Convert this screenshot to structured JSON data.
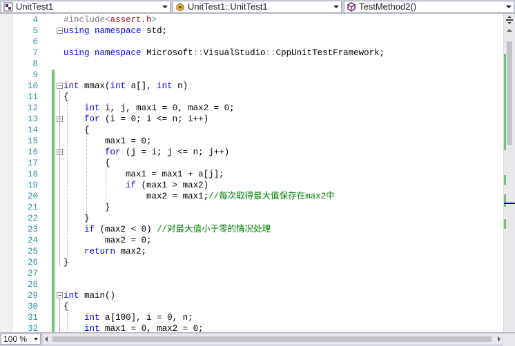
{
  "navbar": {
    "project": {
      "label": "UnitTest1",
      "icon": "project-icon"
    },
    "scope": {
      "label": "UnitTest1::UnitTest1",
      "icon": "class-icon"
    },
    "member": {
      "label": "TestMethod2()",
      "icon": "method-icon"
    }
  },
  "editor": {
    "lines": [
      {
        "n": "4",
        "text": "#include<assert.h>"
      },
      {
        "n": "5",
        "text": "using namespace std;"
      },
      {
        "n": "6",
        "text": ""
      },
      {
        "n": "7",
        "text": "using namespace Microsoft::VisualStudio::CppUnitTestFramework;"
      },
      {
        "n": "8",
        "text": ""
      },
      {
        "n": "9",
        "text": ""
      },
      {
        "n": "10",
        "text": "int mmax(int a[], int n)"
      },
      {
        "n": "11",
        "text": "{"
      },
      {
        "n": "12",
        "text": "    int i, j, max1 = 0, max2 = 0;"
      },
      {
        "n": "13",
        "text": "    for (i = 0; i <= n; i++)"
      },
      {
        "n": "14",
        "text": "    {"
      },
      {
        "n": "15",
        "text": "        max1 = 0;"
      },
      {
        "n": "16",
        "text": "        for (j = i; j <= n; j++)"
      },
      {
        "n": "17",
        "text": "        {"
      },
      {
        "n": "18",
        "text": "            max1 = max1 + a[j];"
      },
      {
        "n": "19",
        "text": "            if (max1 > max2)"
      },
      {
        "n": "20",
        "text": "                max2 = max1;//每次取得最大值保存在max2中"
      },
      {
        "n": "21",
        "text": "        }"
      },
      {
        "n": "22",
        "text": "    }"
      },
      {
        "n": "23",
        "text": "    if (max2 < 0) //对最大值小于零的情况处理"
      },
      {
        "n": "24",
        "text": "        max2 = 0;"
      },
      {
        "n": "25",
        "text": "    return max2;"
      },
      {
        "n": "26",
        "text": "}"
      },
      {
        "n": "27",
        "text": ""
      },
      {
        "n": "28",
        "text": ""
      },
      {
        "n": "29",
        "text": "int main()"
      },
      {
        "n": "30",
        "text": "{"
      },
      {
        "n": "31",
        "text": "    int a[100], i = 0, n;"
      },
      {
        "n": "32",
        "text": "    int max1 = 0, max2 = 0;"
      }
    ]
  },
  "statusbar": {
    "zoom": "100 %"
  },
  "colors": {
    "keyword": "#0000ff",
    "preprocessor": "#808080",
    "string": "#a31515",
    "comment": "#008000",
    "line_number": "#2b91af",
    "change_marker": "#6ec76e"
  }
}
